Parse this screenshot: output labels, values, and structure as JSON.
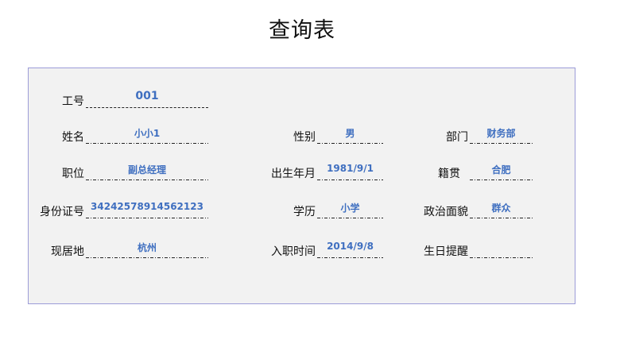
{
  "title": "查询表",
  "fields": {
    "employee_id": {
      "label": "工号",
      "value": "001"
    },
    "name": {
      "label": "姓名",
      "value": "小小1"
    },
    "gender": {
      "label": "性别",
      "value": "男"
    },
    "department": {
      "label": "部门",
      "value": "财务部"
    },
    "position": {
      "label": "职位",
      "value": "副总经理"
    },
    "birth_date": {
      "label": "出生年月",
      "value": "1981/9/1"
    },
    "native_place": {
      "label": "籍贯",
      "value": "合肥"
    },
    "id_number": {
      "label": "身份证号",
      "value": "34242578914562123"
    },
    "education": {
      "label": "学历",
      "value": "小学"
    },
    "political_status": {
      "label": "政治面貌",
      "value": "群众"
    },
    "residence": {
      "label": "现居地",
      "value": "杭州"
    },
    "hire_date": {
      "label": "入职时间",
      "value": "2014/9/8"
    },
    "birthday_reminder": {
      "label": "生日提醒",
      "value": ""
    }
  }
}
